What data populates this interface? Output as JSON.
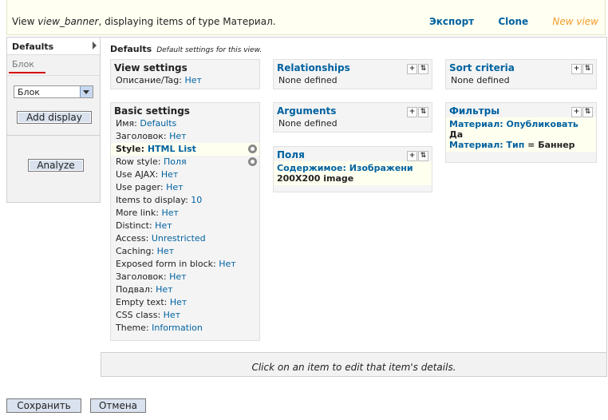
{
  "header": {
    "title_prefix": "View ",
    "view_name": "view_banner",
    "title_suffix": ", displaying items of type Материал.",
    "links": {
      "export": "Экспорт",
      "clone": "Clone",
      "new_view": "New view"
    }
  },
  "sidebar": {
    "default_tab": "Defaults",
    "block_tab": "Блок",
    "display_select": "Блок",
    "add_display": "Add display",
    "analyze": "Analyze"
  },
  "main": {
    "defaults_label": "Defaults",
    "defaults_desc": "Default settings for this view.",
    "view_settings": {
      "title": "View settings",
      "rows": [
        {
          "label": "Описание/Tag: ",
          "value": "Нет"
        }
      ]
    },
    "basic_settings": {
      "title": "Basic settings",
      "rows": [
        {
          "label": "Имя: ",
          "value": "Defaults"
        },
        {
          "label": "Заголовок: ",
          "value": "Нет"
        },
        {
          "label": "Style: ",
          "value": "HTML List"
        },
        {
          "label": "Row style: ",
          "value": "Поля"
        },
        {
          "label": "Use AJAX: ",
          "value": "Нет"
        },
        {
          "label": "Use pager: ",
          "value": "Нет"
        },
        {
          "label": "Items to display: ",
          "value": "10"
        },
        {
          "label": "More link: ",
          "value": "Нет"
        },
        {
          "label": "Distinct: ",
          "value": "Нет"
        },
        {
          "label": "Access: ",
          "value": "Unrestricted"
        },
        {
          "label": "Caching: ",
          "value": "Нет"
        },
        {
          "label": "Exposed form in block: ",
          "value": "Нет"
        },
        {
          "label": "Заголовок: ",
          "value": "Нет"
        },
        {
          "label": "Подвал: ",
          "value": "Нет"
        },
        {
          "label": "Empty text: ",
          "value": "Нет"
        },
        {
          "label": "CSS class: ",
          "value": "Нет"
        },
        {
          "label": "Theme: ",
          "value": "Information"
        }
      ]
    },
    "relationships": {
      "title": "Relationships",
      "text": "None defined"
    },
    "arguments": {
      "title": "Arguments",
      "text": "None defined"
    },
    "fields": {
      "title": "Поля",
      "item": "Содержимое: Изображени",
      "item_detail": "200X200 image"
    },
    "sort_criteria": {
      "title": "Sort criteria",
      "text": "None defined"
    },
    "filters": {
      "title": "Фильтры",
      "f1_link": "Материал: Опубликовать",
      "f1_value": "Да",
      "f2_link": "Материал: Тип",
      "f2_value": " = Баннер"
    },
    "add_icon": "+",
    "rearrange_icon": "⇅"
  },
  "footer_msg": "Click on an item to edit that item's details.",
  "buttons": {
    "save": "Сохранить",
    "cancel": "Отмена"
  }
}
